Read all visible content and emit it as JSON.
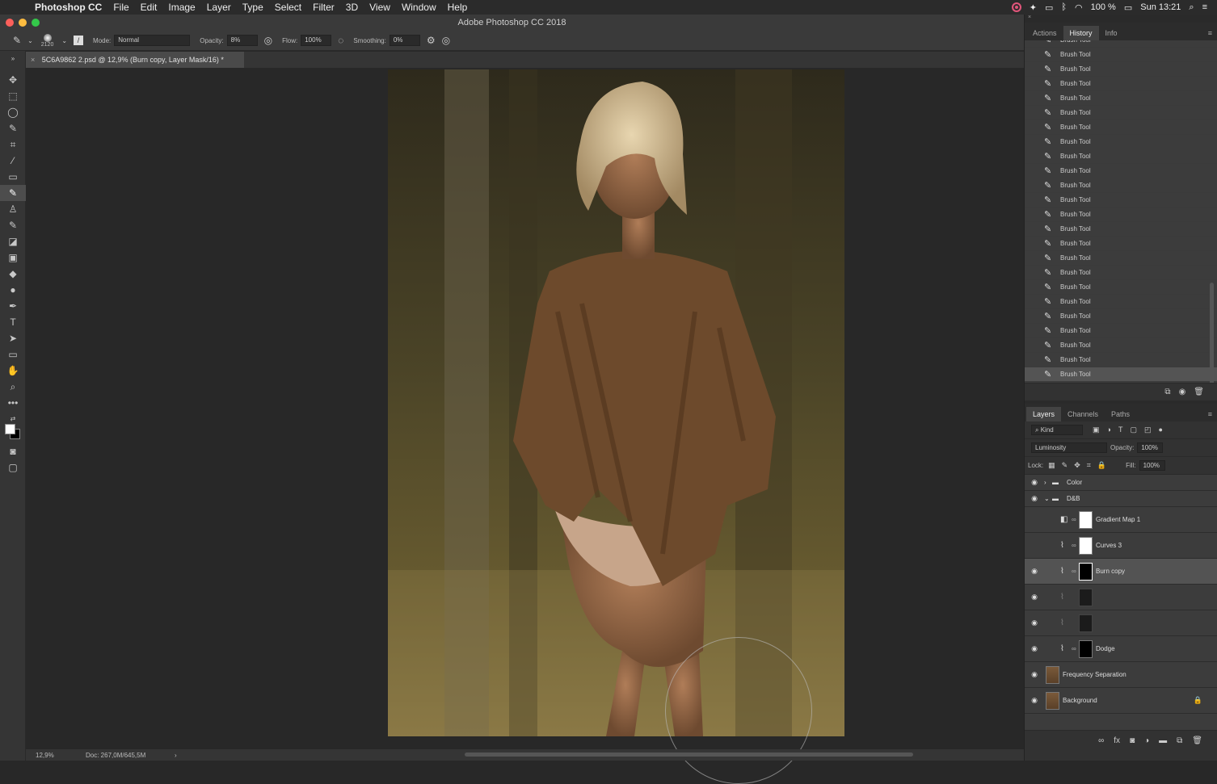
{
  "menubar": {
    "app": "Photoshop CC",
    "items": [
      "File",
      "Edit",
      "Image",
      "Layer",
      "Type",
      "Select",
      "Filter",
      "3D",
      "View",
      "Window",
      "Help"
    ],
    "battery": "100 %",
    "clock": "Sun 13:21"
  },
  "window": {
    "title": "Adobe Photoshop CC 2018"
  },
  "options": {
    "brush_size": "2120",
    "mode_label": "Mode:",
    "mode_value": "Normal",
    "opacity_label": "Opacity:",
    "opacity_value": "8%",
    "flow_label": "Flow:",
    "flow_value": "100%",
    "smoothing_label": "Smoothing:",
    "smoothing_value": "0%"
  },
  "document": {
    "tab_title": "5C6A9862 2.psd @ 12,9% (Burn copy, Layer Mask/16) *",
    "zoom": "12,9%",
    "doc_size": "Doc: 267,0M/645,5M"
  },
  "history_panel": {
    "tabs": [
      "Actions",
      "History",
      "Info"
    ],
    "active_tab": "History",
    "items": [
      "Brush Tool",
      "Brush Tool",
      "Brush Tool",
      "Brush Tool",
      "Brush Tool",
      "Brush Tool",
      "Brush Tool",
      "Brush Tool",
      "Brush Tool",
      "Brush Tool",
      "Brush Tool",
      "Brush Tool",
      "Brush Tool",
      "Brush Tool",
      "Brush Tool",
      "Brush Tool",
      "Brush Tool",
      "Brush Tool",
      "Brush Tool",
      "Brush Tool",
      "Brush Tool",
      "Brush Tool",
      "Brush Tool",
      "Brush Tool"
    ]
  },
  "layers_panel": {
    "tabs": [
      "Layers",
      "Channels",
      "Paths"
    ],
    "filter_label": "Kind",
    "blend_mode": "Luminosity",
    "opacity_label": "Opacity:",
    "opacity_value": "100%",
    "lock_label": "Lock:",
    "fill_label": "Fill:",
    "fill_value": "100%",
    "layers": [
      {
        "name": "Color"
      },
      {
        "name": "D&B"
      },
      {
        "name": "Gradient Map 1"
      },
      {
        "name": "Curves 3"
      },
      {
        "name": "Burn copy"
      },
      {
        "name": ""
      },
      {
        "name": ""
      },
      {
        "name": "Dodge"
      },
      {
        "name": "Frequency Separation"
      },
      {
        "name": "Background"
      }
    ]
  },
  "colors": {
    "accent": "#e0557a",
    "panel_bg": "#323232",
    "canvas_bg": "#282828"
  }
}
